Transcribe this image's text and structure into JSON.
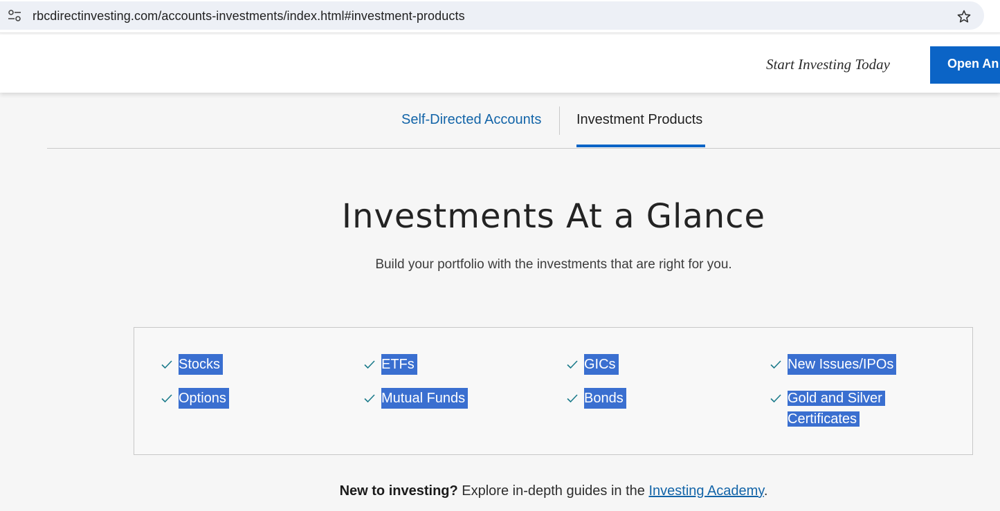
{
  "browser": {
    "url": "rbcdirectinvesting.com/accounts-investments/index.html#investment-products"
  },
  "header": {
    "cta_text": "Start Investing Today",
    "open_account_label": "Open An Account"
  },
  "tabs": [
    {
      "label": "Self-Directed Accounts",
      "active": false
    },
    {
      "label": "Investment Products",
      "active": true
    }
  ],
  "main": {
    "title": "Investments At a Glance",
    "subtitle": "Build your portfolio with the investments that are right for you."
  },
  "products": [
    {
      "label": "Stocks"
    },
    {
      "label": "ETFs"
    },
    {
      "label": "GICs"
    },
    {
      "label": "New Issues/IPOs"
    },
    {
      "label": "Options"
    },
    {
      "label": "Mutual Funds"
    },
    {
      "label": "Bonds"
    },
    {
      "label": "Gold and Silver Certificates"
    }
  ],
  "academy": {
    "lead": "New to investing?",
    "text": " Explore in-depth guides in the ",
    "link": "Investing Academy",
    "end": "."
  },
  "colors": {
    "brand_blue": "#0b64c6",
    "link_blue": "#1264a8",
    "selection_highlight": "#3a6fd0"
  }
}
